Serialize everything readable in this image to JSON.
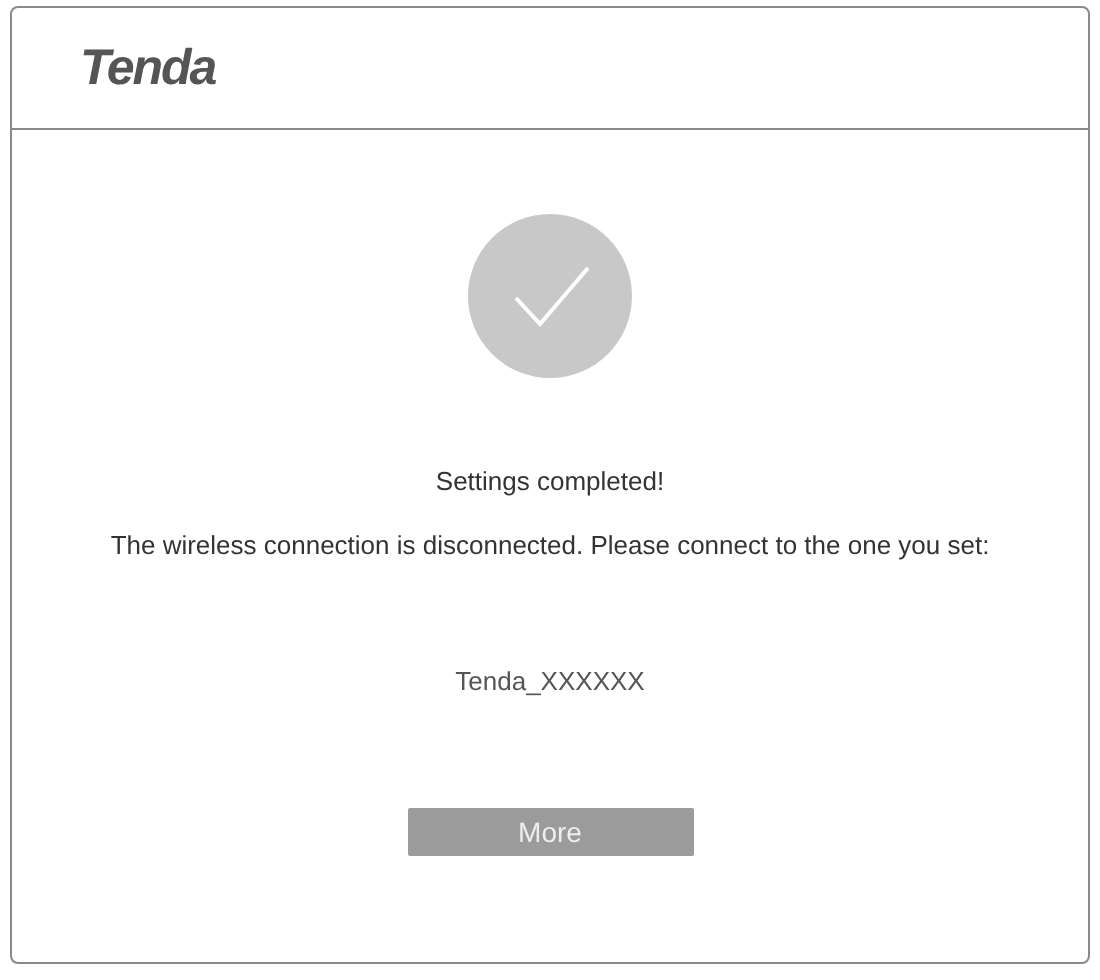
{
  "header": {
    "logo": "Tenda"
  },
  "status": {
    "title": "Settings completed!",
    "message": "The wireless connection is disconnected. Please connect to the one you set:",
    "ssid": "Tenda_XXXXXX"
  },
  "buttons": [
    {
      "label": "More"
    }
  ]
}
